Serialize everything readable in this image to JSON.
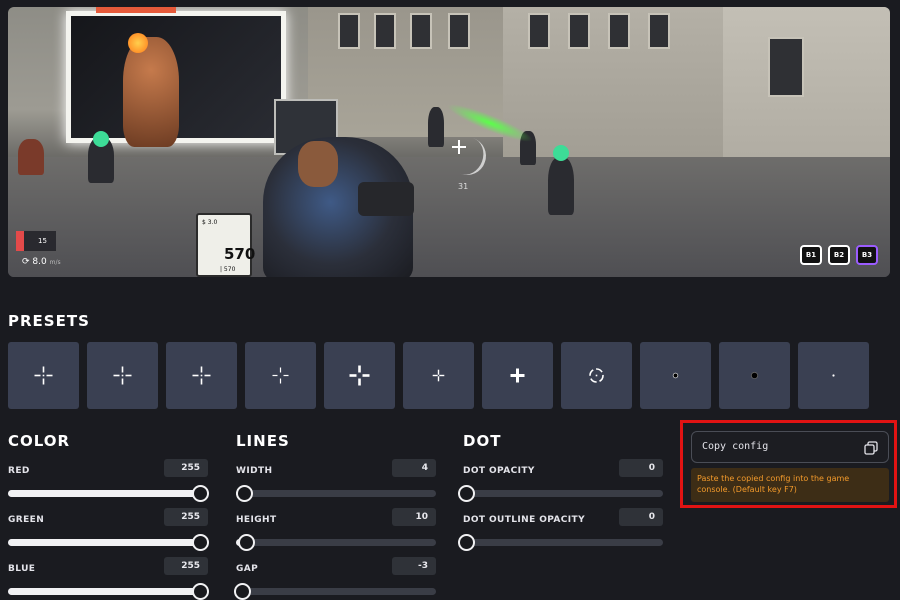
{
  "preview": {
    "card_value": "570",
    "card_small_top": "$ 3.0",
    "card_small_bottom": "| 570",
    "ammo": "31",
    "speed": "8.0",
    "speed_unit": "m/s",
    "hp_badge": "15",
    "key_buttons": [
      {
        "label": "B1",
        "active": false
      },
      {
        "label": "B2",
        "active": false
      },
      {
        "label": "B3",
        "active": true
      }
    ]
  },
  "presets": {
    "title": "PRESETS",
    "items": [
      {
        "style": "gap-cross"
      },
      {
        "style": "gap-cross"
      },
      {
        "style": "gap-cross"
      },
      {
        "style": "gap-cross-thin"
      },
      {
        "style": "gap-cross-bold"
      },
      {
        "style": "plus-small"
      },
      {
        "style": "plus-bold"
      },
      {
        "style": "circle-dot"
      },
      {
        "style": "dot-small"
      },
      {
        "style": "dot-outline"
      },
      {
        "style": "dot-tiny"
      }
    ]
  },
  "color": {
    "title": "COLOR",
    "controls": [
      {
        "label": "RED",
        "value": "255",
        "fraction": 1.0
      },
      {
        "label": "GREEN",
        "value": "255",
        "fraction": 1.0
      },
      {
        "label": "BLUE",
        "value": "255",
        "fraction": 1.0
      }
    ]
  },
  "lines": {
    "title": "LINES",
    "controls": [
      {
        "label": "WIDTH",
        "value": "4",
        "fraction": 0.04
      },
      {
        "label": "HEIGHT",
        "value": "10",
        "fraction": 0.05
      },
      {
        "label": "GAP",
        "value": "-3",
        "fraction": 0.03
      }
    ]
  },
  "dot": {
    "title": "DOT",
    "controls": [
      {
        "label": "DOT OPACITY",
        "value": "0",
        "fraction": 0.0
      },
      {
        "label": "DOT OUTLINE OPACITY",
        "value": "0",
        "fraction": 0.0
      }
    ]
  },
  "copy_config": {
    "label": "Copy config",
    "note": "Paste the copied config into the game console. (Default key F7)",
    "highlight_color": "#e11313"
  },
  "colors": {
    "background": "#1a1b20",
    "preset_tile": "#3a4052",
    "note_text": "#f39a2b"
  }
}
